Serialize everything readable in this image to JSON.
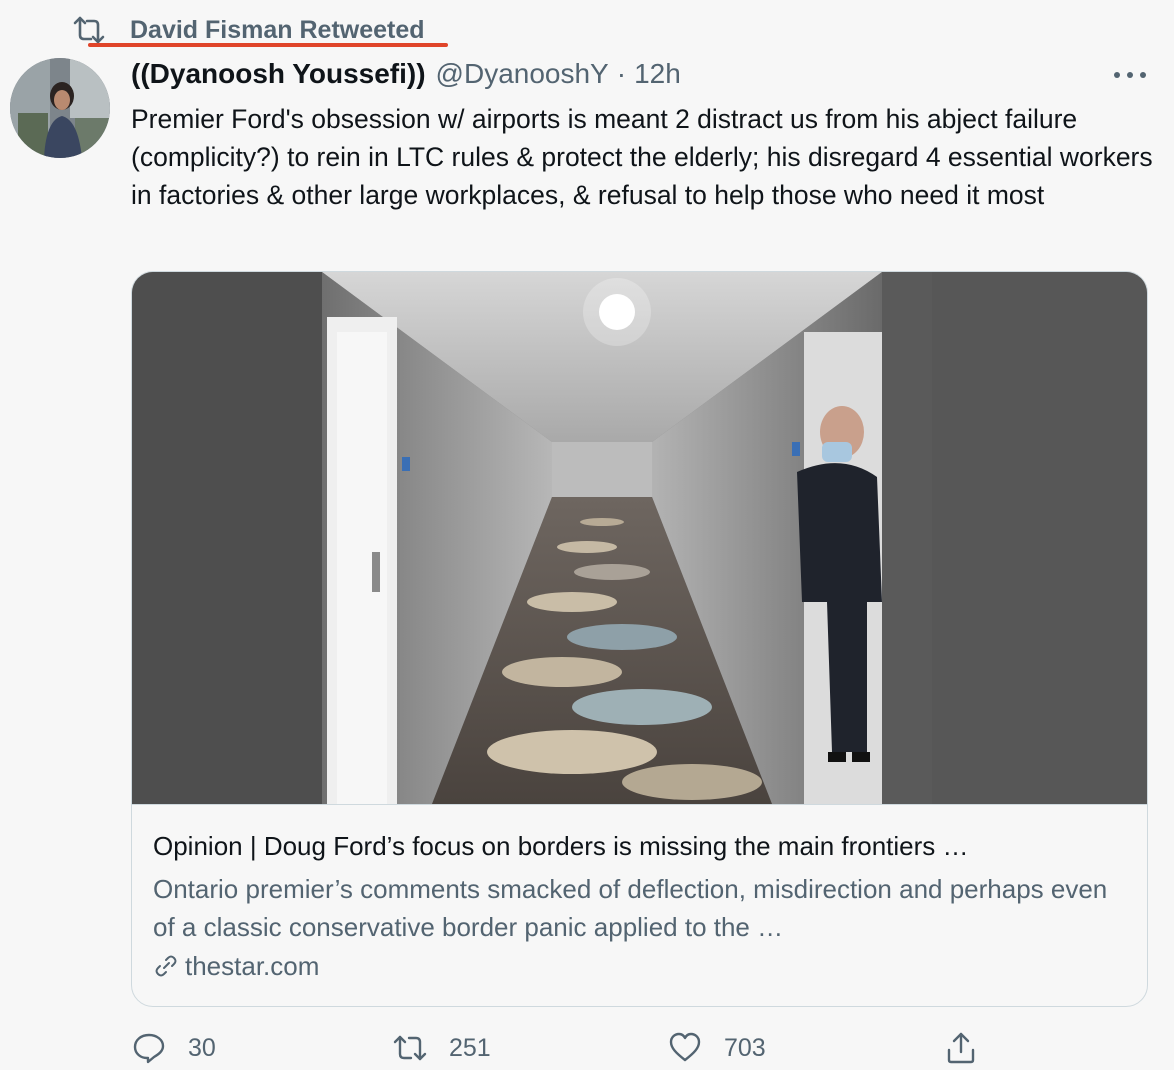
{
  "retweet": {
    "icon": "retweet-icon",
    "label": "David Fisman Retweeted",
    "underline_color": "#e0452a"
  },
  "tweet": {
    "author_name": "((Dyanoosh Youssefi))",
    "handle": "@DyanooshY",
    "separator": "·",
    "time": "12h",
    "text": "Premier Ford's obsession w/ airports is meant 2 distract us from his abject failure (complicity?) to rein in LTC rules & protect the elderly; his disregard 4 essential workers in factories & other large workplaces, & refusal to help those who need it most"
  },
  "card": {
    "title": "Opinion | Doug Ford’s focus on borders is missing the main frontiers …",
    "description": "Ontario premier’s comments smacked of deflection, misdirection and perhaps even of a classic conservative border panic applied to the …",
    "domain": "thestar.com",
    "domain_icon": "link-icon"
  },
  "actions": {
    "reply": {
      "icon": "reply-icon",
      "count": "30"
    },
    "retweet": {
      "icon": "retweet-icon",
      "count": "251"
    },
    "like": {
      "icon": "heart-icon",
      "count": "703"
    },
    "share": {
      "icon": "share-icon"
    }
  },
  "colors": {
    "text_primary": "#0f1419",
    "text_secondary": "#536471",
    "border": "#cfd9de",
    "background": "#f7f7f7"
  }
}
